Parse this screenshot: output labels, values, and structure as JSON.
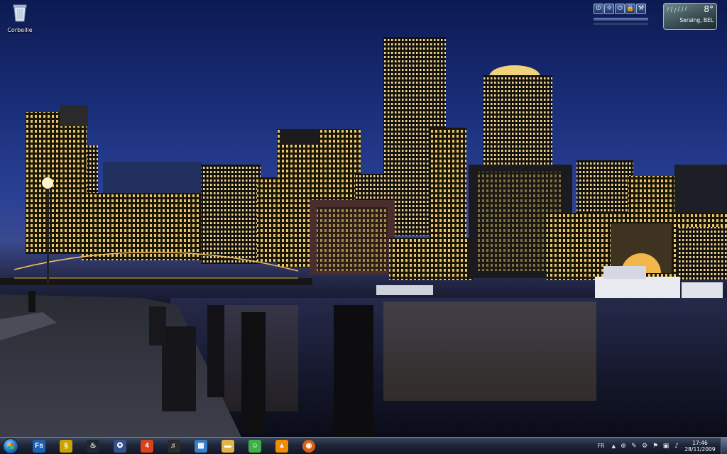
{
  "desktop": {
    "icons": [
      {
        "label": "Corbeille",
        "icon": "recycle-bin-icon"
      }
    ]
  },
  "gadgets": {
    "controls": {
      "buttons": [
        {
          "icon": "power-options-icon",
          "glyph": "⏼"
        },
        {
          "icon": "brightness-icon",
          "glyph": "☼"
        },
        {
          "icon": "shutdown-icon",
          "glyph": "⏻"
        },
        {
          "icon": "lock-icon",
          "glyph": "🔒"
        },
        {
          "icon": "tools-icon",
          "glyph": "⚒"
        }
      ]
    },
    "weather": {
      "temperature": "8°",
      "location": "Seraing, BEL",
      "icon": "rain-icon"
    }
  },
  "taskbar": {
    "start_icon": "windows-start-orb-icon",
    "pinned": [
      {
        "name": "fs",
        "icon": "fs-app-icon",
        "glyph": "Fs",
        "color": "#1d5fb3"
      },
      {
        "name": "yellow-app",
        "icon": "yellow-swirl-icon",
        "glyph": "§",
        "color": "#c9a300"
      },
      {
        "name": "steam",
        "icon": "steam-icon",
        "glyph": "♨",
        "color": "#222631"
      },
      {
        "name": "compass-app",
        "icon": "compass-icon",
        "glyph": "✪",
        "color": "#35508a"
      },
      {
        "name": "four-app",
        "icon": "four-app-icon",
        "glyph": "4",
        "color": "#d7441b"
      },
      {
        "name": "headphones-app",
        "icon": "headphones-icon",
        "glyph": "♬",
        "color": "#2b2b2b"
      },
      {
        "name": "control-panel",
        "icon": "control-panel-icon",
        "glyph": "▦",
        "color": "#3a7cc9"
      },
      {
        "name": "explorer",
        "icon": "folder-icon",
        "glyph": "▬",
        "color": "#e0b44a"
      },
      {
        "name": "messenger",
        "icon": "messenger-icon",
        "glyph": "☺",
        "color": "#3fae49"
      },
      {
        "name": "vlc",
        "icon": "vlc-cone-icon",
        "glyph": "▲",
        "color": "#f08a00"
      },
      {
        "name": "firefox",
        "icon": "firefox-icon",
        "glyph": "◉",
        "color": "#d95f14"
      }
    ],
    "tray": {
      "language": "FR",
      "show_hidden_icon": "chevron-up-icon",
      "icons": [
        {
          "icon": "network-globe-icon",
          "glyph": "⊕"
        },
        {
          "icon": "tray-tool-icon",
          "glyph": "✎"
        },
        {
          "icon": "tray-app-icon",
          "glyph": "⚙"
        },
        {
          "icon": "action-center-flag-icon",
          "glyph": "⚑"
        },
        {
          "icon": "network-icon",
          "glyph": "▣"
        },
        {
          "icon": "volume-icon",
          "glyph": "♪"
        }
      ],
      "time": "17:46",
      "date": "28/11/2009"
    }
  }
}
